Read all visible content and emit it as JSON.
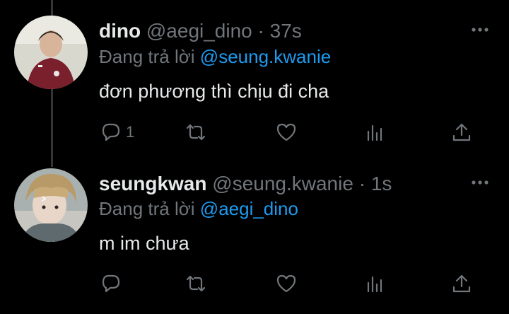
{
  "tweets": [
    {
      "display_name": "dino",
      "handle": "@aegi_dino",
      "separator": "·",
      "time": "37s",
      "reply_prefix": "Đang trả lời",
      "reply_to": "@seung.kwanie",
      "text": "đơn phương thì chịu đi cha",
      "reply_count": "1",
      "avatar_icon": "dino-avatar"
    },
    {
      "display_name": "seungkwan",
      "handle": "@seung.kwanie",
      "separator": "·",
      "time": "1s",
      "reply_prefix": "Đang trả lời",
      "reply_to": "@aegi_dino",
      "text": "m im chưa",
      "reply_count": "",
      "avatar_icon": "seungkwan-avatar"
    }
  ],
  "icons": {
    "reply": "reply-icon",
    "retweet": "retweet-icon",
    "like": "like-icon",
    "analytics": "analytics-icon",
    "share": "share-icon",
    "more": "more-icon"
  },
  "colors": {
    "background": "#000000",
    "text": "#e7e9ea",
    "muted": "#71767b",
    "accent": "#1d9bf0"
  }
}
